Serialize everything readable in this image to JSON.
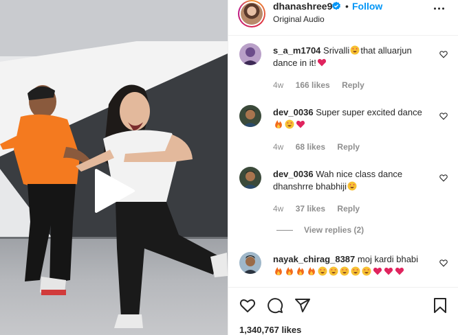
{
  "post": {
    "username": "dhanashree9",
    "verified": true,
    "follow_label": "Follow",
    "separator": "•",
    "audio": "Original Audio",
    "likes_count": "1,340,767 likes"
  },
  "comments": [
    {
      "user": "s_a_m1704",
      "text_a": "Srivalli",
      "text_b": "that alluarjun dance in it!",
      "time": "4w",
      "likes": "166 likes",
      "reply": "Reply"
    },
    {
      "user": "dev_0036",
      "text_a": "Super super excited dance",
      "time": "4w",
      "likes": "68 likes",
      "reply": "Reply"
    },
    {
      "user": "dev_0036",
      "text_a": "Wah nice class dance dhanshrre bhabhiji",
      "time": "4w",
      "likes": "37 likes",
      "reply": "Reply"
    },
    {
      "user": "nayak_chirag_8387",
      "text_a": "moj kardi bhabi"
    }
  ],
  "view_replies": "View replies (2)",
  "icons": {
    "like": "heart-icon",
    "comment": "comment-icon",
    "share": "paper-plane-icon",
    "save": "bookmark-icon",
    "play": "play-icon",
    "more": "more-options-icon"
  },
  "colors": {
    "accent": "#0095f6",
    "heart_red": "#e0245e",
    "muted": "#8e8e8e",
    "text": "#262626"
  }
}
